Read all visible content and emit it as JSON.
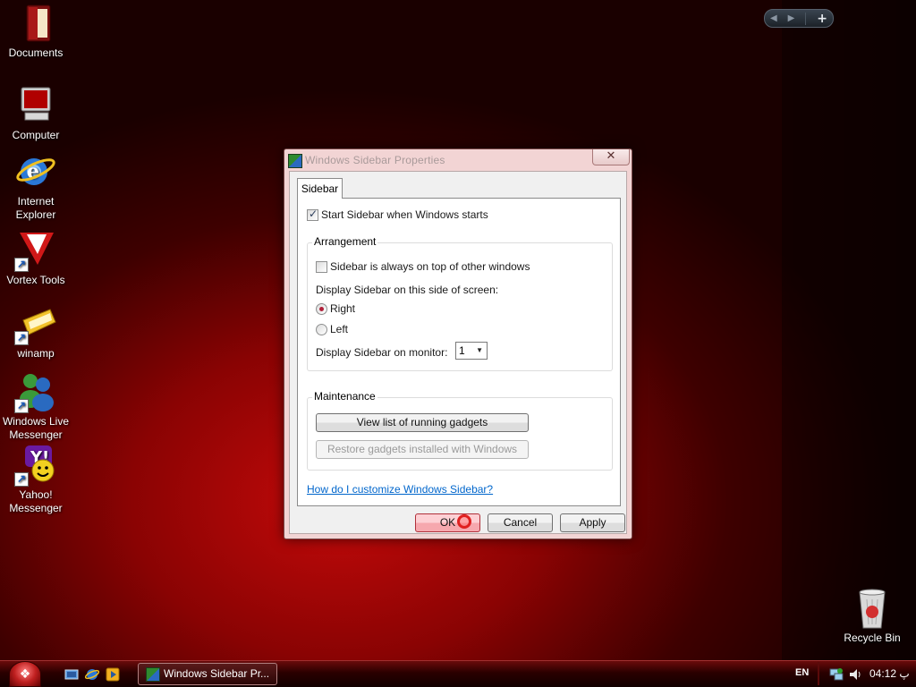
{
  "desktop": {
    "icons": [
      {
        "label": "Documents"
      },
      {
        "label": "Computer"
      },
      {
        "label": "Internet Explorer"
      },
      {
        "label": "Vortex Tools"
      },
      {
        "label": "winamp"
      },
      {
        "label": "Windows Live Messenger"
      },
      {
        "label": "Yahoo! Messenger"
      },
      {
        "label": "Recycle Bin"
      }
    ]
  },
  "dialog": {
    "title": "Windows Sidebar Properties",
    "close_glyph": "✕",
    "tab": "Sidebar",
    "start_with_windows": {
      "label": "Start Sidebar when Windows starts",
      "checked": true
    },
    "arrangement": {
      "title": "Arrangement",
      "always_on_top": {
        "label": "Sidebar is always on top of other windows",
        "checked": false
      },
      "side_label": "Display Sidebar on this side of screen:",
      "right": {
        "label": "Right",
        "selected": true
      },
      "left": {
        "label": "Left",
        "selected": false
      },
      "monitor_label": "Display Sidebar on monitor:",
      "monitor_value": "1"
    },
    "maintenance": {
      "title": "Maintenance",
      "view_gadgets": "View list of running gadgets",
      "restore_gadgets": "Restore gadgets installed with Windows"
    },
    "help_link": "How do I customize Windows Sidebar?",
    "buttons": {
      "ok": "OK",
      "cancel": "Cancel",
      "apply": "Apply"
    }
  },
  "taskbar": {
    "active_window": "Windows Sidebar Pr...",
    "language": "EN",
    "clock": "04:12 پ"
  },
  "colors": {
    "accent": "#c40a0a",
    "link": "#0066cc"
  }
}
